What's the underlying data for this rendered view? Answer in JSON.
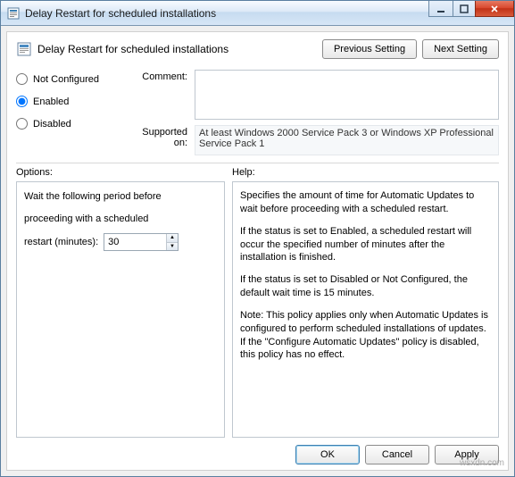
{
  "window": {
    "title": "Delay Restart for scheduled installations"
  },
  "header": {
    "title": "Delay Restart for scheduled installations",
    "previous_setting": "Previous Setting",
    "next_setting": "Next Setting"
  },
  "state": {
    "not_configured": "Not Configured",
    "enabled": "Enabled",
    "disabled": "Disabled",
    "selected": "enabled"
  },
  "meta": {
    "comment_label": "Comment:",
    "comment_value": "",
    "supported_label": "Supported on:",
    "supported_value": "At least Windows 2000 Service Pack 3 or Windows XP Professional Service Pack 1"
  },
  "panels": {
    "options_label": "Options:",
    "help_label": "Help:"
  },
  "options": {
    "wait_text_1": "Wait the following period before",
    "wait_text_2": "proceeding with a scheduled",
    "restart_label": "restart (minutes):",
    "restart_value": "30"
  },
  "help": {
    "p1": "Specifies the amount of time for Automatic Updates to wait before proceeding with a scheduled restart.",
    "p2": "If the status is set to Enabled, a scheduled restart will occur the specified number of minutes after the installation is finished.",
    "p3": "If the status is set to Disabled or Not Configured, the default wait time is 15 minutes.",
    "p4": "Note: This policy applies only when Automatic Updates is configured to perform scheduled installations of updates. If the \"Configure Automatic Updates\" policy is disabled, this policy has no effect."
  },
  "footer": {
    "ok": "OK",
    "cancel": "Cancel",
    "apply": "Apply"
  },
  "watermark": "wsxdn.com"
}
